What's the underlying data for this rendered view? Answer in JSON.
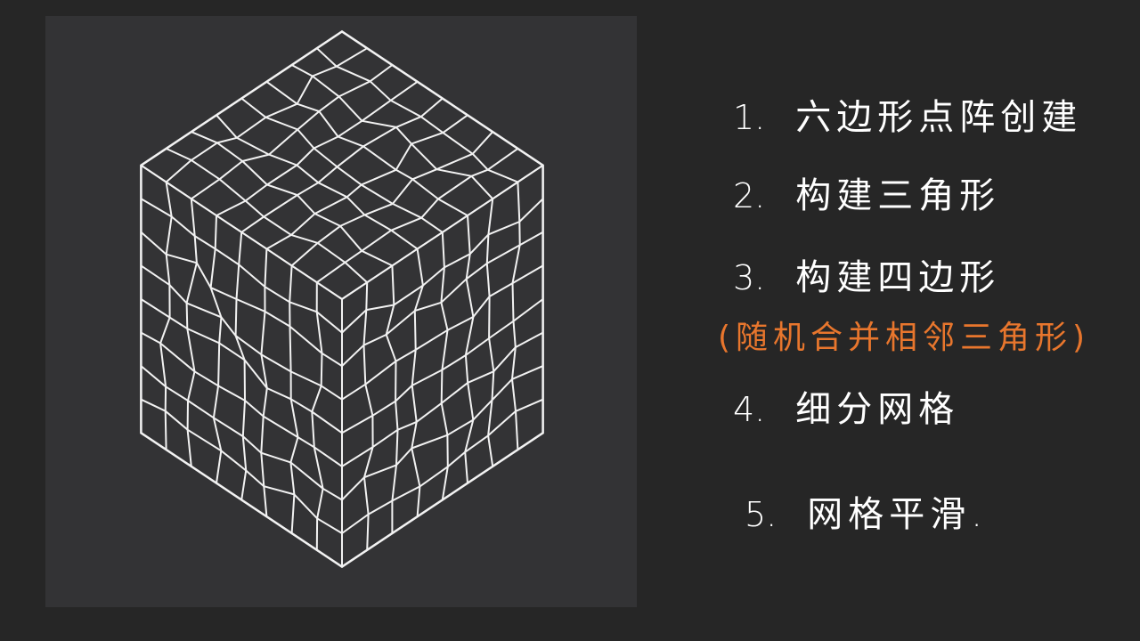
{
  "colors": {
    "background": "#262626",
    "panel": "#333335",
    "mesh": "#f2f2f2",
    "step_text": "#ffffff",
    "note_text": "#e8762d"
  },
  "steps": [
    {
      "number": "1.",
      "text": "六边形点阵创建"
    },
    {
      "number": "2.",
      "text": "构建三角形"
    },
    {
      "number": "3.",
      "text": "构建四边形"
    },
    {
      "number": "4.",
      "text": "细分网格"
    },
    {
      "number": "5.",
      "text": "网格平滑."
    }
  ],
  "note": "(随机合并相邻三角形)"
}
